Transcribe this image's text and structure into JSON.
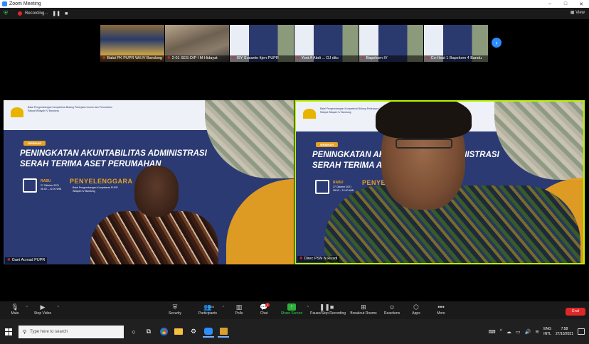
{
  "window": {
    "title": "Zoom Meeting",
    "minimize": "–",
    "maximize": "□",
    "close": "✕"
  },
  "topbar": {
    "recording_label": "Recording...",
    "view_label": "View"
  },
  "thumbnails": [
    {
      "name": "Balai PK PUPR Wil.IV Bandung",
      "muted": true
    },
    {
      "name": "2-01 SES-DIP I M-Hidayat",
      "muted": true
    },
    {
      "name": "ISY Susanto Itjen PUPR",
      "muted": true
    },
    {
      "name": "Yoni A Abdi ... DJ ditu",
      "muted": true
    },
    {
      "name": "Bapekom IV",
      "muted": true
    },
    {
      "name": "Co-Host 1 Bapekom 4 Bandu",
      "muted": true
    }
  ],
  "slide": {
    "org_text": "Balai Pengembangan Kompetensi Bidang Pekerjaan Umum dan Perumahan Rakyat Wilayah IV Bandung",
    "webinar_tag": "WEBINAR",
    "headline_1": "PENINGKATAN AKUNTABILITAS ADMINISTRASI",
    "headline_2": "SERAH TERIMA ASET PERUMAHAN",
    "day": "RABU",
    "date": "27 Oktober 2021",
    "time": "08.00 – 12.00 WIB",
    "organizer_label": "PENYELENGGARA",
    "organizer_text": "Balai Pengembangan Kompetensi PUPR Wilayah IV Bandung"
  },
  "tiles": [
    {
      "name": "Gani Acmad PUPR",
      "muted": true
    },
    {
      "name": "Direc PSN N Rusdi",
      "muted": true
    }
  ],
  "toolbar": {
    "mute": "Mute",
    "stop_video": "Stop Video",
    "security": "Security",
    "participants": "Participants",
    "participants_count": "203",
    "polls": "Polls",
    "chat": "Chat",
    "chat_badge": "1",
    "share_screen": "Share Screen",
    "pause_recording": "Pause/Stop Recording",
    "breakout_rooms": "Breakout Rooms",
    "reactions": "Reactions",
    "apps": "Apps",
    "more": "More",
    "end": "End"
  },
  "taskbar": {
    "search_placeholder": "Type here to search",
    "lang_1": "ENG",
    "lang_2": "INTL",
    "time": "7:58",
    "date": "27/10/2021"
  },
  "colors": {
    "zoom_blue": "#2d8cff",
    "end_red": "#e02828",
    "active_speaker": "#b8f300",
    "share_green": "#2bb03a"
  }
}
